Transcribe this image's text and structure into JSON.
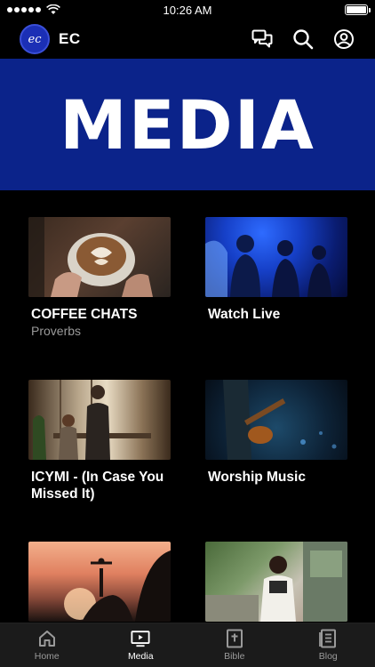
{
  "status_bar": {
    "time": "10:26 AM",
    "battery_level": 1.0
  },
  "header": {
    "brand": "EC",
    "logo_text": "ec",
    "icons": [
      "chat-icon",
      "search-icon",
      "account-icon"
    ]
  },
  "banner": {
    "title": "MEDIA",
    "bg_color": "#0b238a"
  },
  "cards": [
    {
      "title": "COFFEE CHATS",
      "subtitle": "Proverbs",
      "thumb": "coffee"
    },
    {
      "title": "Watch Live",
      "subtitle": "",
      "thumb": "live"
    },
    {
      "title": "ICYMI -  (In Case You Missed It)",
      "subtitle": "",
      "thumb": "icymi"
    },
    {
      "title": "Worship Music",
      "subtitle": "",
      "thumb": "worship"
    },
    {
      "title": "",
      "subtitle": "",
      "thumb": "sunset"
    },
    {
      "title": "",
      "subtitle": "",
      "thumb": "camera"
    }
  ],
  "bottom_nav": [
    {
      "label": "Home",
      "icon": "home-icon"
    },
    {
      "label": "Media",
      "icon": "media-icon",
      "active": true
    },
    {
      "label": "Bible",
      "icon": "bible-icon"
    },
    {
      "label": "Blog",
      "icon": "blog-icon"
    }
  ]
}
